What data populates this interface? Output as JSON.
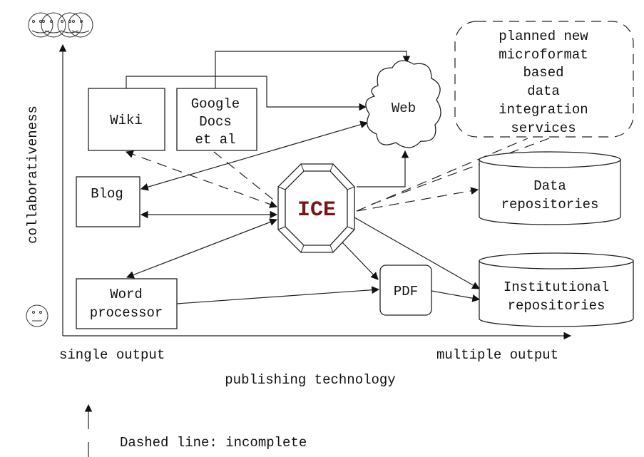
{
  "axes": {
    "y_label": "collaborativeness",
    "x_label": "publishing technology",
    "x_left": "single output",
    "x_right": "multiple output",
    "y_top_icon": "group-of-smiley-faces-icon",
    "y_bottom_icon": "single-neutral-face-icon"
  },
  "nodes": {
    "wiki": "Wiki",
    "gdocs": [
      "Google",
      "Docs",
      "et al"
    ],
    "blog": "Blog",
    "word": [
      "Word",
      "processor"
    ],
    "web": "Web",
    "ice": "ICE",
    "pdf": "PDF",
    "data_repos": [
      "Data",
      "repositories"
    ],
    "inst_repos": [
      "Institutional",
      "repositories"
    ],
    "planned": [
      "planned new",
      "microformat",
      "based",
      "data",
      "integration",
      "services"
    ]
  },
  "colors": {
    "ice_text": "#7a1515"
  },
  "legend": {
    "dashed": "Dashed line: incomplete"
  }
}
